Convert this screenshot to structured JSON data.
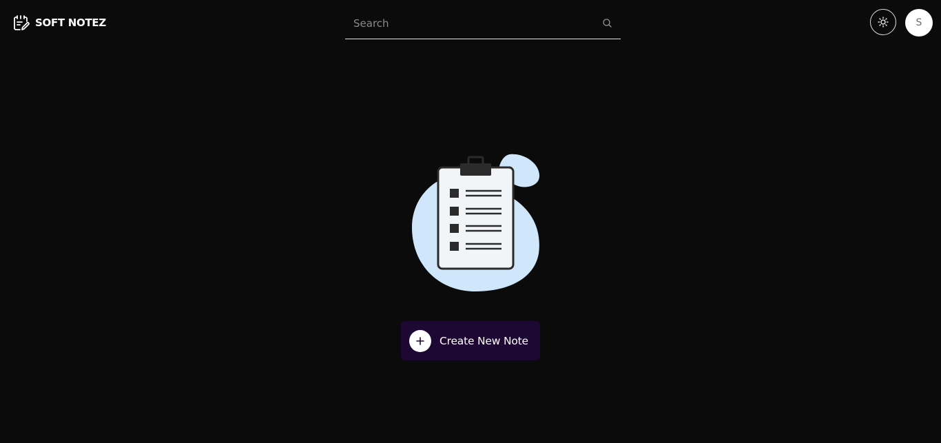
{
  "header": {
    "app_name": "SOFT NOTEZ",
    "logo_icon": "notepad-pencil-icon",
    "search": {
      "placeholder": "Search",
      "value": "",
      "icon": "search-icon"
    },
    "theme_toggle_icon": "sun-icon",
    "avatar_initial": "S"
  },
  "empty_state": {
    "illustration": "clipboard-checklist-icon",
    "create_button_label": "Create New Note",
    "create_button_icon": "plus-icon"
  },
  "colors": {
    "background": "#0b0b0b",
    "button_background": "#1d0733",
    "illustration_blob": "#cfe6fb",
    "text": "#ffffff"
  }
}
